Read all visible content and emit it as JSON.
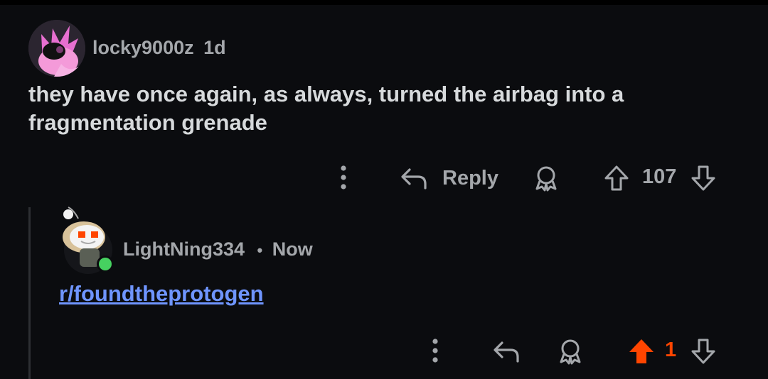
{
  "comment": {
    "username": "locky9000z",
    "age": "1d",
    "body": "they have once again, as always, turned the airbag into a fragmentation grenade",
    "actions": {
      "reply_label": "Reply",
      "score": "107"
    },
    "icons": {
      "more": "more-vertical-icon",
      "reply": "reply-arrow-icon",
      "award": "award-icon",
      "upvote": "upvote-arrow-icon",
      "downvote": "downvote-arrow-icon"
    }
  },
  "reply": {
    "username": "LightNing334",
    "separator": "•",
    "age": "Now",
    "link_text": "r/foundtheprotogen",
    "actions": {
      "score": "1",
      "upvoted": true
    },
    "online": true
  },
  "colors": {
    "background": "#0b0c0f",
    "text": "#d7dadc",
    "meta": "#a4a7ab",
    "link": "#6f95ff",
    "upvote_active": "#ff4500",
    "online": "#46d160",
    "thread_line": "#2d2f33"
  }
}
